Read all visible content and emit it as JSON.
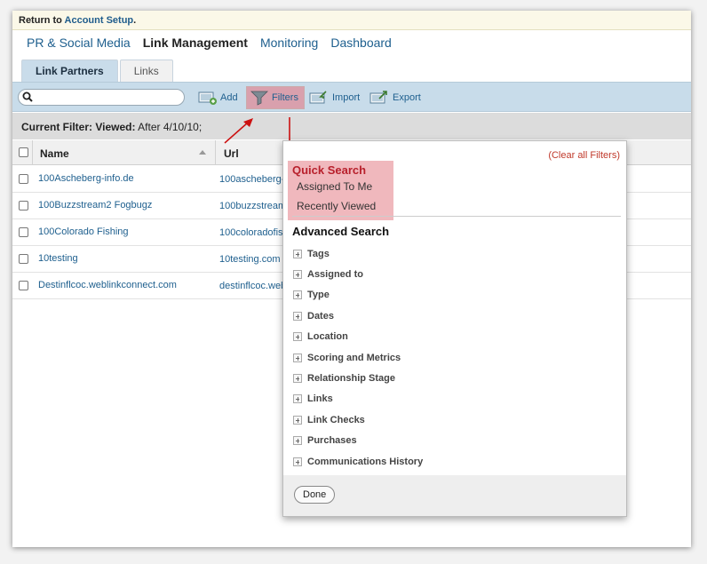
{
  "topbar": {
    "prefix": "Return to ",
    "link": "Account Setup",
    "suffix": "."
  },
  "nav": [
    {
      "label": "PR & Social Media"
    },
    {
      "label": "Link Management"
    },
    {
      "label": "Monitoring"
    },
    {
      "label": "Dashboard"
    }
  ],
  "tabs": [
    {
      "label": "Link Partners"
    },
    {
      "label": "Links"
    }
  ],
  "toolbar": {
    "search_value": "",
    "add_label": "Add",
    "filters_label": "Filters",
    "import_label": "Import",
    "export_label": "Export"
  },
  "filter_bar": {
    "prefix": "Current Filter: Viewed:",
    "value": " After 4/10/10;"
  },
  "table": {
    "columns": [
      {
        "label": "Name"
      },
      {
        "label": "Url"
      }
    ],
    "rows": [
      {
        "name": "100Ascheberg-info.de",
        "url": "100ascheberg-"
      },
      {
        "name": "100Buzzstream2 Fogbugz",
        "url": "100buzzstream"
      },
      {
        "name": "100Colorado Fishing",
        "url": "100coloradofis"
      },
      {
        "name": "10testing",
        "url": "10testing.com"
      },
      {
        "name": "Destinflcoc.weblinkconnect.com",
        "url": "destinflcoc.web"
      }
    ]
  },
  "dropdown": {
    "clear_all": "(Clear all Filters)",
    "quick_search_title": "Quick Search",
    "quick_search_items": [
      "Assigned To Me",
      "Recently Viewed"
    ],
    "advanced_title": "Advanced Search",
    "advanced_items": [
      "Tags",
      "Assigned to",
      "Type",
      "Dates",
      "Location",
      "Scoring and Metrics",
      "Relationship Stage",
      "Links",
      "Link Checks",
      "Purchases",
      "Communications History"
    ],
    "done_label": "Done"
  },
  "colors": {
    "link": "#1e5f8e",
    "toolbar_bg": "#c8dcea",
    "highlight": "#f0b8bd",
    "arrow": "#cc1111"
  }
}
